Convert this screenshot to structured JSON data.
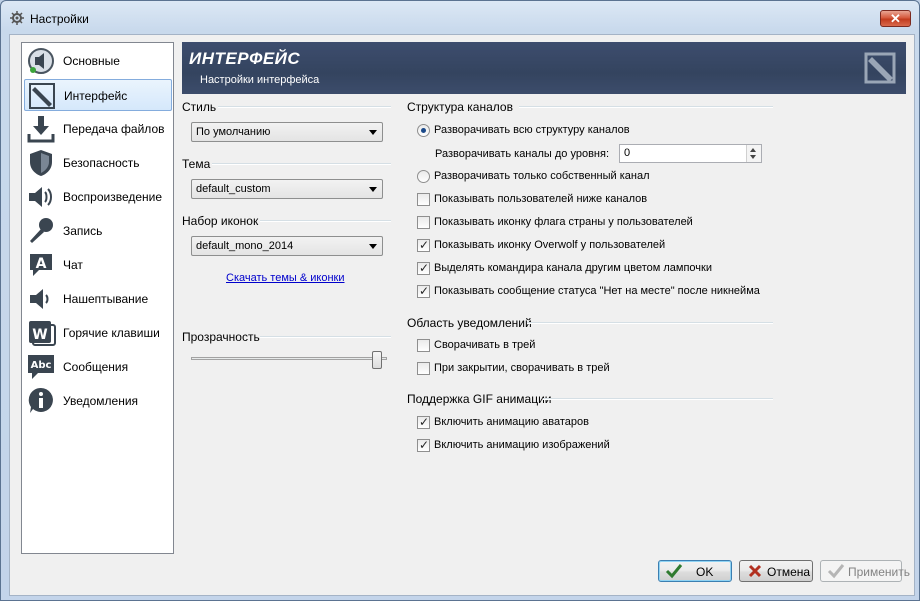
{
  "window": {
    "title": "Настройки",
    "close_label": "✕"
  },
  "sidebar": {
    "items": [
      {
        "label": "Основные",
        "icon": "speaker-general-icon"
      },
      {
        "label": "Интерфейс",
        "icon": "interface-pen-icon",
        "selected": true
      },
      {
        "label": "Передача файлов",
        "icon": "download-icon"
      },
      {
        "label": "Безопасность",
        "icon": "shield-icon"
      },
      {
        "label": "Воспроизведение",
        "icon": "speaker-icon"
      },
      {
        "label": "Запись",
        "icon": "microphone-icon"
      },
      {
        "label": "Чат",
        "icon": "chat-a-icon"
      },
      {
        "label": "Нашептывание",
        "icon": "whisper-speaker-icon"
      },
      {
        "label": "Горячие клавиши",
        "icon": "hotkeys-w-icon"
      },
      {
        "label": "Сообщения",
        "icon": "abc-messages-icon"
      },
      {
        "label": "Уведомления",
        "icon": "info-icon"
      }
    ]
  },
  "header": {
    "title": "ИНТЕРФЕЙС",
    "subtitle": "Настройки интерфейса"
  },
  "left": {
    "style_title": "Стиль",
    "style_value": "По умолчанию",
    "theme_title": "Тема",
    "theme_value": "default_custom",
    "iconset_title": "Набор иконок",
    "iconset_value": "default_mono_2014",
    "download_link": "Скачать темы & иконки",
    "transparency_title": "Прозрачность",
    "transparency_level": 1.0
  },
  "channels": {
    "title": "Структура каналов",
    "expand_all": "Разворачивать всю структуру каналов",
    "expand_level_label": "Разворачивать каналы до уровня:",
    "expand_level_value": "0",
    "expand_own": "Разворачивать только собственный канал",
    "options": [
      {
        "label": "Показывать пользователей ниже каналов",
        "checked": false
      },
      {
        "label": "Показывать иконку флага страны у пользователей",
        "checked": false
      },
      {
        "label": "Показывать иконку Overwolf у пользователей",
        "checked": true
      },
      {
        "label": "Выделять командира канала другим цветом лампочки",
        "checked": true
      },
      {
        "label": "Показывать сообщение статуса \"Нет на месте\" после никнейма",
        "checked": true
      }
    ]
  },
  "notify": {
    "title": "Область уведомлений",
    "options": [
      {
        "label": "Сворачивать в трей",
        "checked": false
      },
      {
        "label": "При закрытии, сворачивать в трей",
        "checked": false
      }
    ]
  },
  "gif": {
    "title": "Поддержка GIF анимации",
    "options": [
      {
        "label": "Включить анимацию аватаров",
        "checked": true
      },
      {
        "label": "Включить анимацию изображений",
        "checked": true
      }
    ]
  },
  "buttons": {
    "ok": "OK",
    "cancel": "Отмена",
    "apply": "Применить"
  }
}
